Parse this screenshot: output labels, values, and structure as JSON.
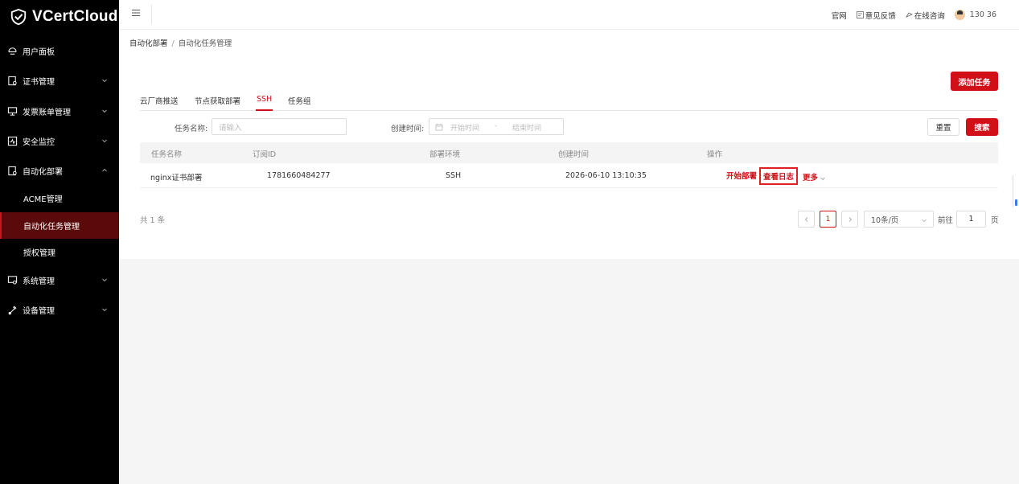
{
  "brand": {
    "name": "VCertCloud"
  },
  "sidebar": {
    "items": [
      {
        "label": "用户面板",
        "icon": "dashboard-icon",
        "expandable": false
      },
      {
        "label": "证书管理",
        "icon": "certificate-icon",
        "expandable": true
      },
      {
        "label": "发票账单管理",
        "icon": "invoice-icon",
        "expandable": true
      },
      {
        "label": "安全监控",
        "icon": "monitor-icon",
        "expandable": true
      },
      {
        "label": "自动化部署",
        "icon": "deploy-icon",
        "expandable": true,
        "expanded": true
      },
      {
        "label": "系统管理",
        "icon": "system-icon",
        "expandable": true
      },
      {
        "label": "设备管理",
        "icon": "device-icon",
        "expandable": true
      }
    ],
    "subitems": [
      {
        "label": "ACME管理",
        "active": false
      },
      {
        "label": "自动化任务管理",
        "active": true
      },
      {
        "label": "授权管理",
        "active": false
      }
    ]
  },
  "header": {
    "links": [
      "官网",
      "意见反馈",
      "在线咨询"
    ],
    "user": "130        36"
  },
  "breadcrumb": {
    "parent": "自动化部署",
    "separator": "/",
    "current": "自动化任务管理"
  },
  "toolbar": {
    "add_label": "添加任务"
  },
  "tabs": [
    {
      "label": "云厂商推送",
      "active": false
    },
    {
      "label": "节点获取部署",
      "active": false
    },
    {
      "label": "SSH",
      "active": true
    },
    {
      "label": "任务组",
      "active": false
    }
  ],
  "filters": {
    "task_name_label": "任务名称:",
    "task_name_placeholder": "请输入",
    "created_label": "创建时间:",
    "start_placeholder": "开始时间",
    "dash": "-",
    "end_placeholder": "结束时间",
    "reset_label": "重置",
    "search_label": "搜索"
  },
  "table": {
    "columns": [
      "任务名称",
      "订阅ID",
      "部署环境",
      "创建时间",
      "操作"
    ],
    "rows": [
      {
        "name": "nginx证书部署",
        "sub_id": "1781660484277",
        "env": "SSH",
        "created": "2026-06-10 13:10:35",
        "actions": {
          "start": "开始部署",
          "log": "查看日志",
          "more": "更多"
        }
      }
    ]
  },
  "pagination": {
    "total": "共 1 条",
    "current_page": "1",
    "page_size": "10条/页",
    "goto_prefix": "前往",
    "goto_value": "1",
    "goto_suffix": "页"
  },
  "colors": {
    "accent": "#d10f16",
    "sidebar_bg": "#000000",
    "active_bg": "#5a0a0a"
  }
}
